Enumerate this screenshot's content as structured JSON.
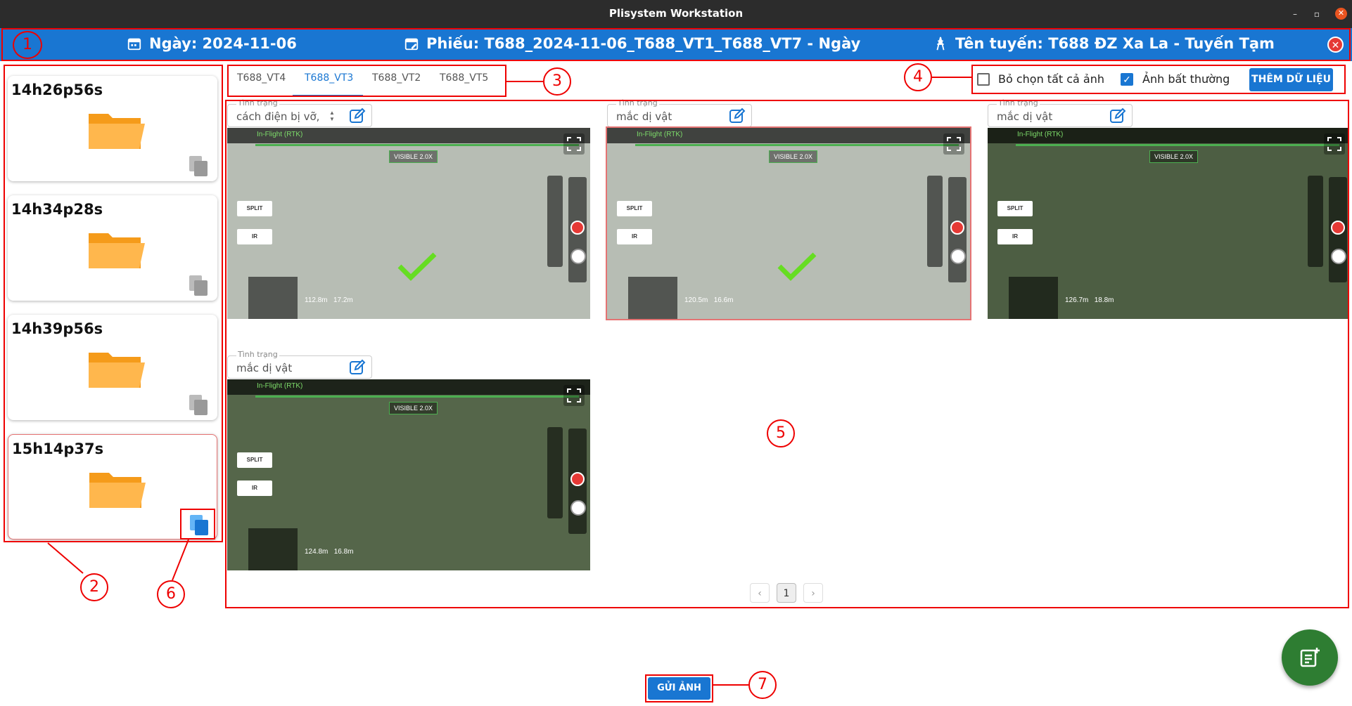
{
  "window": {
    "title": "Plisystem Workstation",
    "minimize": "–",
    "maximize": "▫",
    "close": "✕"
  },
  "header": {
    "date": "Ngày: 2024-11-06",
    "ticket": "Phiếu: T688_2024-11-06_T688_VT1_T688_VT7 - Ngày",
    "route": "Tên tuyến: T688 ĐZ Xa La - Tuyến Tạm",
    "close": "✕"
  },
  "sidebar": {
    "items": [
      {
        "label": "14h26p56s"
      },
      {
        "label": "14h34p28s"
      },
      {
        "label": "14h39p56s"
      },
      {
        "label": "15h14p37s",
        "selected": true
      }
    ]
  },
  "tabs": {
    "items": [
      "T688_VT4",
      "T688_VT3",
      "T688_VT2",
      "T688_VT5"
    ],
    "active_index": 1
  },
  "options": {
    "deselect_all": "Bỏ chọn tất cả ảnh",
    "deselect_checked": false,
    "abnormal": "Ảnh bất thường",
    "abnormal_checked": true,
    "add_data": "THÊM DỮ LIỆU"
  },
  "gallery": {
    "status_legend": "Tình trạng",
    "images": [
      {
        "status": "cách điện bị vỡ,",
        "checked": true,
        "flight": "In-Flight (RTK)",
        "visible": "VISIBLE 2.0X",
        "split": "SPLIT",
        "ir": "IR",
        "alt": "112.8m",
        "dist": "17.2m"
      },
      {
        "status": "mắc dị vật",
        "checked": true,
        "flight": "In-Flight (RTK)",
        "visible": "VISIBLE 2.0X",
        "split": "SPLIT",
        "ir": "IR",
        "alt": "120.5m",
        "dist": "16.6m"
      },
      {
        "status": "mắc dị vật",
        "checked": false,
        "flight": "In-Flight (RTK)",
        "visible": "VISIBLE 2.0X",
        "split": "SPLIT",
        "ir": "IR",
        "alt": "126.7m",
        "dist": "18.8m"
      },
      {
        "status": "mắc dị vật",
        "checked": false,
        "flight": "In-Flight (RTK)",
        "visible": "VISIBLE 2.0X",
        "split": "SPLIT",
        "ir": "IR",
        "alt": "124.8m",
        "dist": "16.8m"
      }
    ]
  },
  "pagination": {
    "prev": "‹",
    "current": "1",
    "next": "›"
  },
  "footer": {
    "send": "GỬI ẢNH"
  },
  "annotations": [
    "1",
    "2",
    "3",
    "4",
    "5",
    "6",
    "7"
  ],
  "colors": {
    "primary": "#1976d2",
    "annotation": "#e00000",
    "folder": "#ffa726",
    "fab": "#2e7d32"
  }
}
